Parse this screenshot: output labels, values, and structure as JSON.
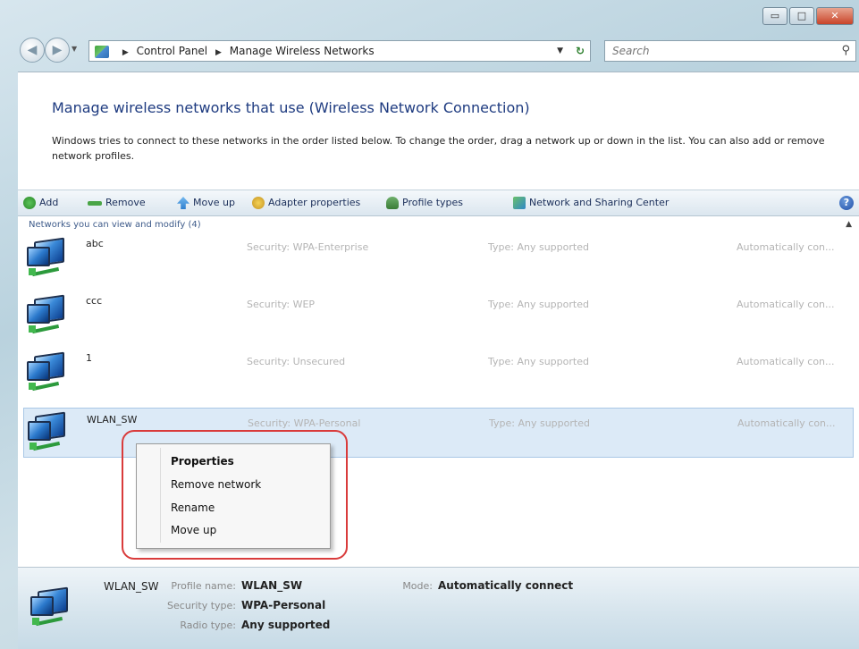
{
  "window": {
    "controls": {
      "minimize": "▭",
      "maximize": "□",
      "close": "✕"
    }
  },
  "address_bar": {
    "crumbs": [
      "Control Panel",
      "Manage Wireless Networks"
    ],
    "search_placeholder": "Search"
  },
  "page": {
    "heading": "Manage wireless networks that use (Wireless Network Connection)",
    "description": "Windows tries to connect to these networks in the order listed below. To change the order, drag a network up or down in the list. You can also add or remove network profiles."
  },
  "toolbar": {
    "add": "Add",
    "remove": "Remove",
    "move_up": "Move up",
    "adapter_properties": "Adapter properties",
    "profile_types": "Profile types",
    "network_sharing": "Network and Sharing Center",
    "help": "?"
  },
  "list": {
    "group_header": "Networks you can view and modify (4)",
    "rows": [
      {
        "name": "abc",
        "security": "Security: WPA-Enterprise",
        "type": "Type: Any supported",
        "mode": "Automatically con..."
      },
      {
        "name": "ccc",
        "security": "Security: WEP",
        "type": "Type: Any supported",
        "mode": "Automatically con..."
      },
      {
        "name": "1",
        "security": "Security: Unsecured",
        "type": "Type: Any supported",
        "mode": "Automatically con..."
      },
      {
        "name": "WLAN_SW",
        "security": "Security: WPA-Personal",
        "type": "Type: Any supported",
        "mode": "Automatically con..."
      }
    ]
  },
  "context_menu": {
    "items": [
      "Properties",
      "Remove network",
      "Rename",
      "Move up"
    ]
  },
  "details": {
    "name": "WLAN_SW",
    "profile_name_label": "Profile name:",
    "profile_name_value": "WLAN_SW",
    "security_type_label": "Security type:",
    "security_type_value": "WPA-Personal",
    "radio_type_label": "Radio type:",
    "radio_type_value": "Any supported",
    "mode_label": "Mode:",
    "mode_value": "Automatically connect"
  }
}
